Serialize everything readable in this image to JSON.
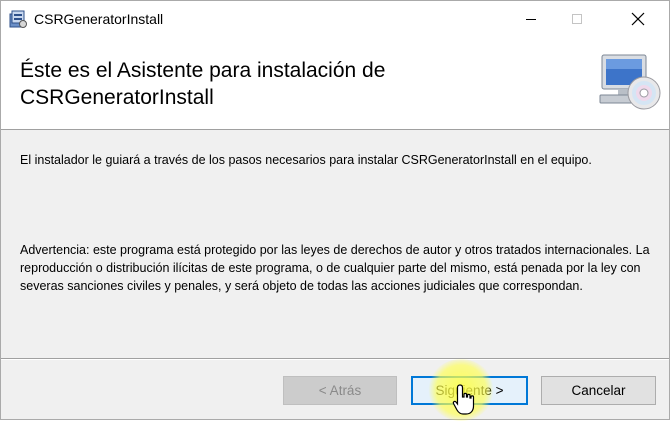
{
  "window": {
    "title": "CSRGeneratorInstall",
    "icon": "installer-icon",
    "controls": [
      "minimize-icon",
      "maximize-icon",
      "close-icon"
    ]
  },
  "header": {
    "heading": "Éste es el Asistente para instalación de CSRGeneratorInstall",
    "graphic": "computer-cd-icon"
  },
  "content": {
    "intro": "El instalador le guiará a través de los pasos necesarios para instalar CSRGeneratorInstall en el equipo.",
    "warning": "Advertencia: este programa está protegido por las leyes de derechos de autor y otros tratados internacionales. La reproducción o distribución ilícitas de este programa, o de cualquier parte del mismo, está penada por la ley con severas sanciones civiles y penales, y será objeto de todas las acciones judiciales que correspondan."
  },
  "buttons": {
    "back": "< Atrás",
    "next": "Siguiente >",
    "cancel": "Cancelar"
  },
  "colors": {
    "accent": "#0078d7",
    "cursor_highlight": "#ffff3c"
  }
}
